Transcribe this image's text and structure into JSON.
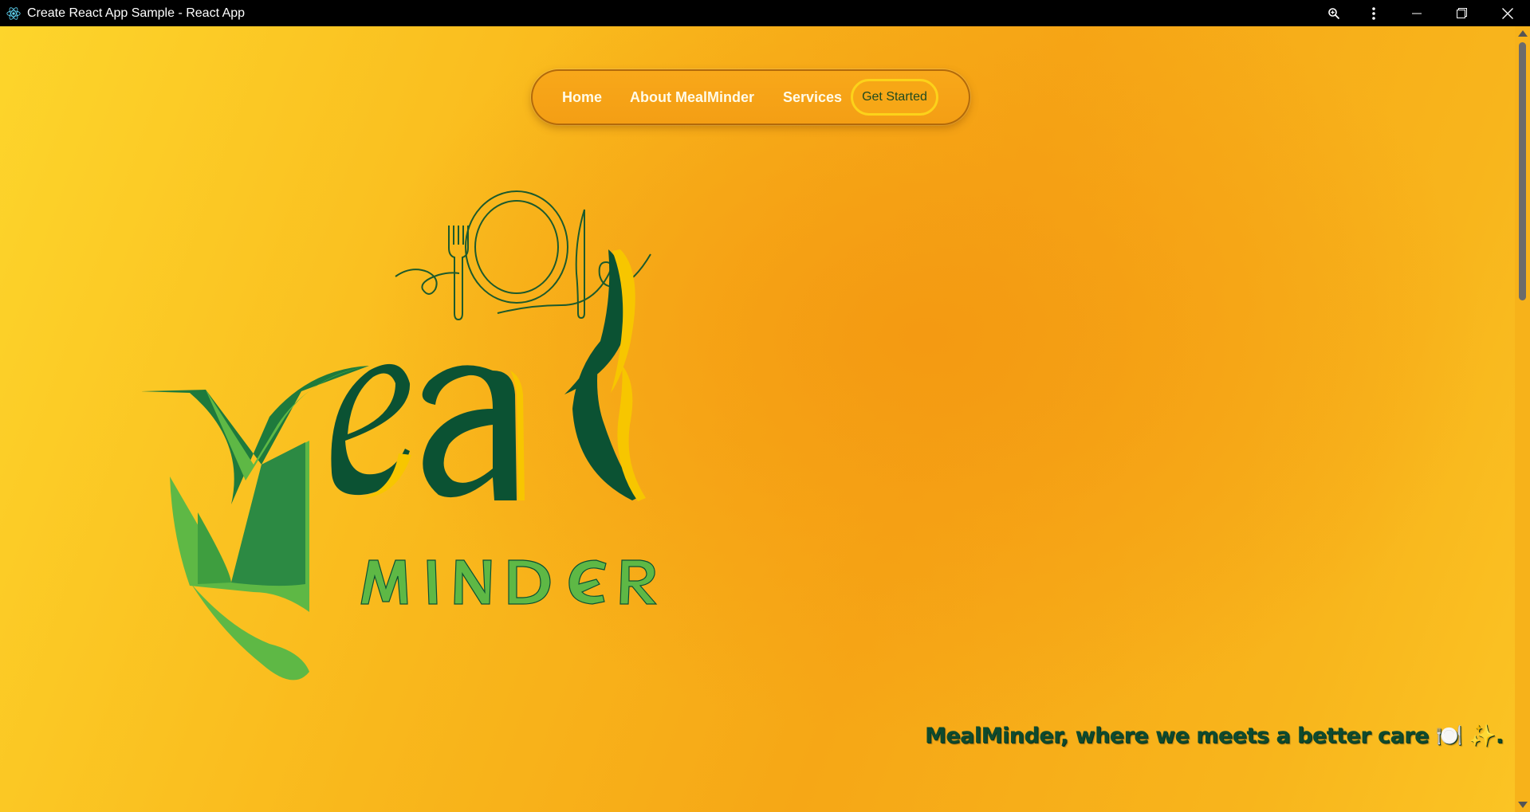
{
  "window": {
    "title": "Create React App Sample - React App",
    "icons": {
      "app": "react-logo-icon",
      "zoom": "zoom-icon",
      "menu": "kebab-menu-icon",
      "minimize": "minimize-icon",
      "restore": "restore-icon",
      "close": "close-icon"
    }
  },
  "nav": {
    "home": "Home",
    "about": "About MealMinder",
    "services": "Services",
    "cta": "Get Started"
  },
  "logo": {
    "brand_line1": "eal",
    "brand_line2": "MINDER"
  },
  "hero": {
    "tagline": "MealMinder, where we meets a better care 🍽️ ✨."
  },
  "colors": {
    "background_light": "#fdd52b",
    "background_dark": "#f49a12",
    "brand_dark_green": "#0b5233",
    "brand_leaf_green": "#5cb848",
    "accent_yellow": "#f7c600"
  }
}
